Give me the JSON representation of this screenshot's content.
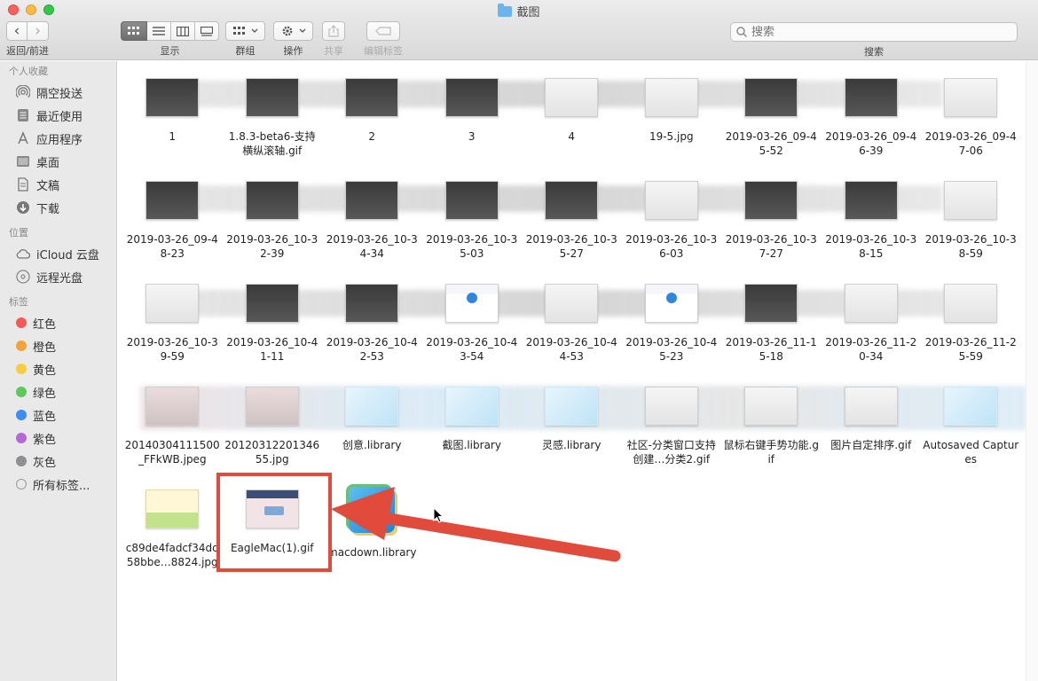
{
  "window": {
    "title": "截图"
  },
  "toolbar": {
    "nav_label": "返回/前进",
    "back_glyph": "‹",
    "forward_glyph": "›",
    "view_label": "显示",
    "group_label": "群组",
    "action_label": "操作",
    "share_label": "共享",
    "edit_tags_label": "编辑标签",
    "search_placeholder": "搜索",
    "search_label": "搜索"
  },
  "sidebar": {
    "favorites_title": "个人收藏",
    "favorites": [
      {
        "label": "隔空投送",
        "icon": "airdrop-icon"
      },
      {
        "label": "最近使用",
        "icon": "recents-icon"
      },
      {
        "label": "应用程序",
        "icon": "applications-icon"
      },
      {
        "label": "桌面",
        "icon": "desktop-icon"
      },
      {
        "label": "文稿",
        "icon": "documents-icon"
      },
      {
        "label": "下载",
        "icon": "downloads-icon"
      }
    ],
    "locations_title": "位置",
    "locations": [
      {
        "label": "iCloud 云盘",
        "icon": "icloud-icon"
      },
      {
        "label": "远程光盘",
        "icon": "remote-disc-icon"
      }
    ],
    "tags_title": "标签",
    "tags": [
      {
        "label": "红色",
        "color": "#f45a55"
      },
      {
        "label": "橙色",
        "color": "#f6a23a"
      },
      {
        "label": "黄色",
        "color": "#f6ce3f"
      },
      {
        "label": "绿色",
        "color": "#5bc95b"
      },
      {
        "label": "蓝色",
        "color": "#3a8df5"
      },
      {
        "label": "紫色",
        "color": "#b469d6"
      },
      {
        "label": "灰色",
        "color": "#8e8e93"
      },
      {
        "label": "所有标签...",
        "color": ""
      }
    ]
  },
  "files": [
    {
      "name": "1",
      "thumb": "dark"
    },
    {
      "name": "1.8.3-beta6-支持横纵滚轴.gif",
      "thumb": "dark"
    },
    {
      "name": "2",
      "thumb": "dark"
    },
    {
      "name": "3",
      "thumb": "dark"
    },
    {
      "name": "4",
      "thumb": "light"
    },
    {
      "name": "19-5.jpg",
      "thumb": "light"
    },
    {
      "name": "2019-03-26_09-45-52",
      "thumb": "dark"
    },
    {
      "name": "2019-03-26_09-46-39",
      "thumb": "dark"
    },
    {
      "name": "2019-03-26_09-47-06",
      "thumb": "light"
    },
    {
      "name": "2019-03-26_09-48-23",
      "thumb": "dark"
    },
    {
      "name": "2019-03-26_10-32-39",
      "thumb": "dark"
    },
    {
      "name": "2019-03-26_10-34-34",
      "thumb": "dark"
    },
    {
      "name": "2019-03-26_10-35-03",
      "thumb": "dark"
    },
    {
      "name": "2019-03-26_10-35-27",
      "thumb": "dark"
    },
    {
      "name": "2019-03-26_10-36-03",
      "thumb": "light"
    },
    {
      "name": "2019-03-26_10-37-27",
      "thumb": "dark"
    },
    {
      "name": "2019-03-26_10-38-15",
      "thumb": "dark"
    },
    {
      "name": "2019-03-26_10-38-59",
      "thumb": "light"
    },
    {
      "name": "2019-03-26_10-39-59",
      "thumb": "light"
    },
    {
      "name": "2019-03-26_10-41-11",
      "thumb": "dark"
    },
    {
      "name": "2019-03-26_10-42-53",
      "thumb": "dark"
    },
    {
      "name": "2019-03-26_10-43-54",
      "thumb": "web"
    },
    {
      "name": "2019-03-26_10-44-53",
      "thumb": "light"
    },
    {
      "name": "2019-03-26_10-45-23",
      "thumb": "web"
    },
    {
      "name": "2019-03-26_11-15-18",
      "thumb": "dark"
    },
    {
      "name": "2019-03-26_11-20-34",
      "thumb": "light"
    },
    {
      "name": "2019-03-26_11-25-59",
      "thumb": "light"
    },
    {
      "name": "20140304111500_FFkWB.jpeg",
      "thumb": "photo"
    },
    {
      "name": "2012031220134655.jpg",
      "thumb": "photo"
    },
    {
      "name": "创意.library",
      "thumb": "lib"
    },
    {
      "name": "截图.library",
      "thumb": "lib"
    },
    {
      "name": "灵感.library",
      "thumb": "lib"
    },
    {
      "name": "社区-分类窗口支持创建…分类2.gif",
      "thumb": "light"
    },
    {
      "name": "鼠标右键手势功能.gif",
      "thumb": "light"
    },
    {
      "name": "图片自定排序.gif",
      "thumb": "light"
    },
    {
      "name": "Autosaved Captures",
      "thumb": "lib"
    },
    {
      "name": "c89de4fadcf34dd58bbe…8824.jpg",
      "thumb": "cartoon"
    },
    {
      "name": "EagleMac(1).gif",
      "thumb": "eagle"
    },
    {
      "name": "macdown.library",
      "thumb": "macdown"
    }
  ],
  "colors": {
    "highlight": "#e14b3c",
    "accent": "#3a8df5"
  }
}
